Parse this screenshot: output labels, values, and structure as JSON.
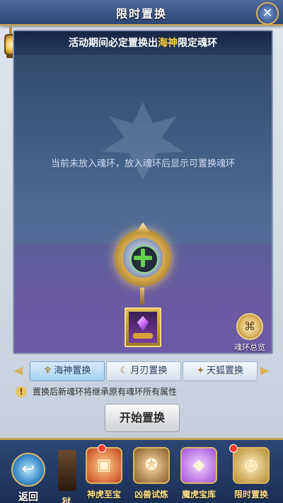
{
  "header": {
    "title": "限时置换",
    "close_symbol": "✕"
  },
  "banner": {
    "prefix": "活动期间必定置换出",
    "highlight": "海神",
    "suffix": "限定魂环"
  },
  "hint": "当前未放入魂环，放入魂环后显示可置换魂环",
  "slot": {
    "plus_symbol": "+"
  },
  "overview": {
    "label": "魂环总览"
  },
  "tabs": [
    {
      "label": "海神置换",
      "active": true
    },
    {
      "label": "月刃置换",
      "active": false
    },
    {
      "label": "天狐置换",
      "active": false
    }
  ],
  "note": "置换后新魂环将继承原有魂环所有属性",
  "start_button": "开始置换",
  "bottom_nav": {
    "back_label": "返回",
    "partial_label": "狱",
    "items": [
      {
        "label": "神虎至宝",
        "icon": "treasure-chest-icon",
        "has_badge": true
      },
      {
        "label": "凶兽试炼",
        "icon": "beast-emblem-icon",
        "has_badge": false
      },
      {
        "label": "魔虎宝库",
        "icon": "gem-vault-icon",
        "has_badge": false
      },
      {
        "label": "限时置换",
        "icon": "clock-icon",
        "has_badge": true
      }
    ]
  },
  "colors": {
    "accent_gold": "#caa552",
    "highlight_yellow": "#ffd23a",
    "plus_green": "#64d24a"
  }
}
